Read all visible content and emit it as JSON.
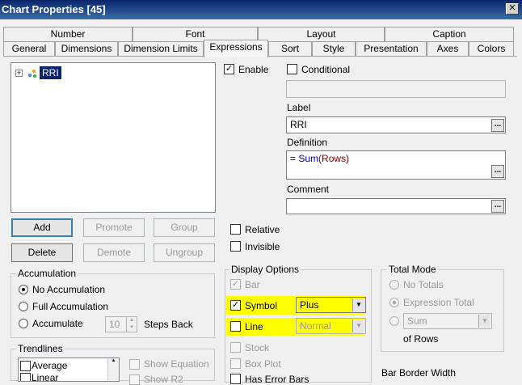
{
  "window": {
    "title": "Chart Properties [45]",
    "close_glyph": "✕"
  },
  "tabs_top": [
    "Number",
    "Font",
    "Layout",
    "Caption"
  ],
  "tabs_bottom": [
    "General",
    "Dimensions",
    "Dimension Limits",
    "Expressions",
    "Sort",
    "Style",
    "Presentation",
    "Axes",
    "Colors"
  ],
  "active_tab": "Expressions",
  "tree": {
    "expand_glyph": "+",
    "item": "RRI"
  },
  "buttons": {
    "add": "Add",
    "promote": "Promote",
    "group": "Group",
    "delete": "Delete",
    "demote": "Demote",
    "ungroup": "Ungroup"
  },
  "accumulation": {
    "title": "Accumulation",
    "options": [
      "No Accumulation",
      "Full Accumulation",
      "Accumulate"
    ],
    "selected": "No Accumulation",
    "steps_value": "10",
    "steps_label": "Steps Back"
  },
  "trendlines": {
    "title": "Trendlines",
    "items": [
      "Average",
      "Linear"
    ],
    "show_equation": "Show Equation",
    "show_r2": "Show R2"
  },
  "expression": {
    "enable_label": "Enable",
    "enable_checked": true,
    "conditional_label": "Conditional",
    "conditional_checked": false,
    "label_caption": "Label",
    "label_value": "RRI",
    "definition_caption": "Definition",
    "definition_prefix": "= ",
    "definition_func": "Sum",
    "definition_args": "(Rows)",
    "comment_caption": "Comment",
    "comment_value": "",
    "ellipsis": "..."
  },
  "flags": {
    "relative": "Relative",
    "invisible": "Invisible"
  },
  "display_options": {
    "title": "Display Options",
    "bar": "Bar",
    "symbol": "Symbol",
    "symbol_value": "Plus",
    "line": "Line",
    "line_value": "Normal",
    "stock": "Stock",
    "box_plot": "Box Plot",
    "error_bars": "Has Error Bars",
    "highlight_color": "#ffff00"
  },
  "total_mode": {
    "title": "Total Mode",
    "no_totals": "No Totals",
    "expression_total": "Expression Total",
    "sum_value": "Sum",
    "of_rows": "of Rows"
  },
  "bar_border_width": "Bar Border Width",
  "icons": {
    "check": "✓",
    "dropdown": "▼",
    "spin_up": "▲",
    "spin_down": "▼"
  }
}
